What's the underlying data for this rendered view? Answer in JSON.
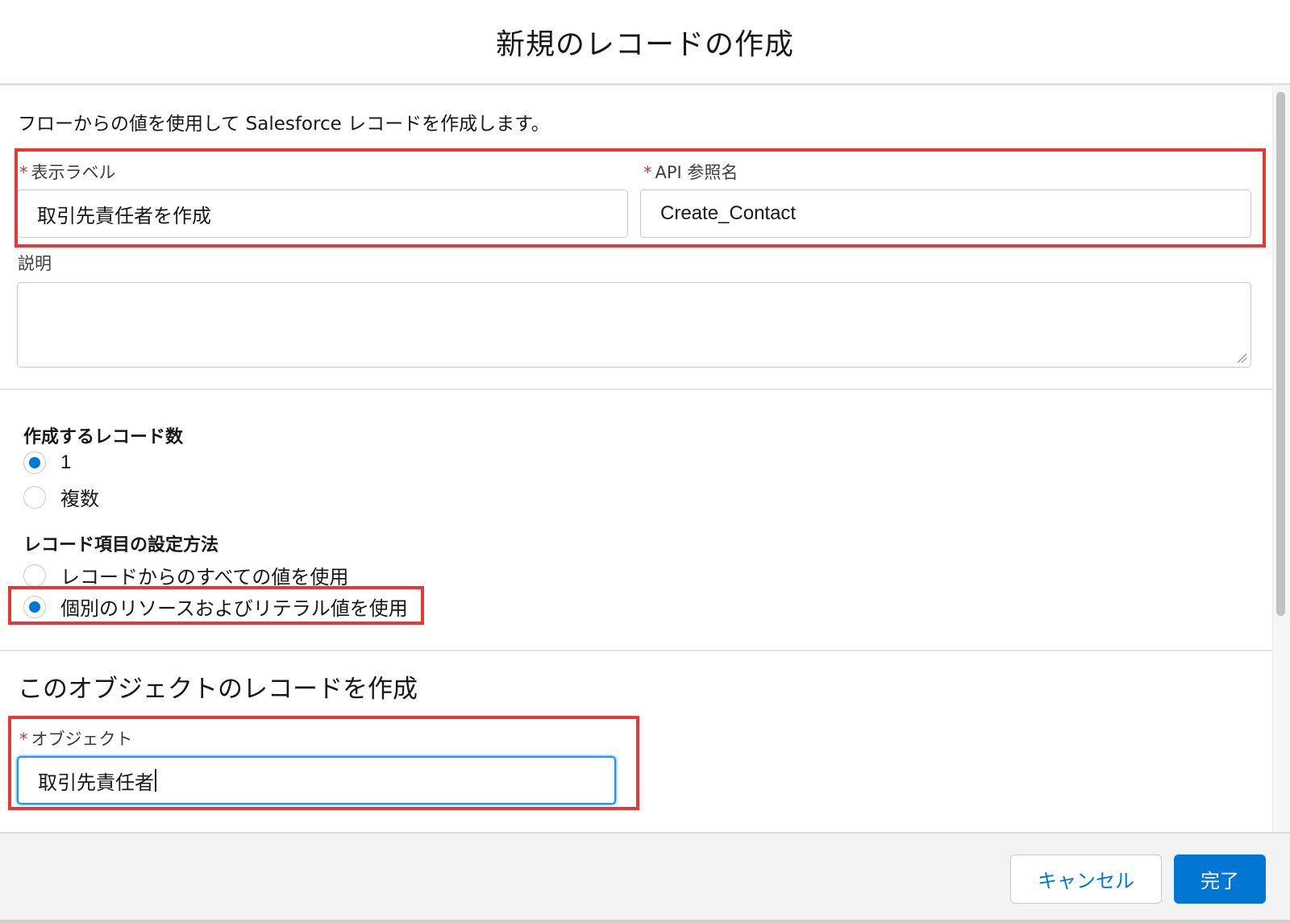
{
  "header": {
    "title": "新規のレコードの作成"
  },
  "content": {
    "description": "フローからの値を使用して Salesforce レコードを作成します。",
    "label_field": {
      "label": "表示ラベル",
      "required_mark": "*",
      "value": "取引先責任者を作成"
    },
    "api_field": {
      "label": "API 参照名",
      "required_mark": "*",
      "value": "Create_Contact"
    },
    "description_field": {
      "label": "説明",
      "value": ""
    },
    "record_count": {
      "label": "作成するレコード数",
      "options": [
        {
          "label": "1",
          "checked": true
        },
        {
          "label": "複数",
          "checked": false
        }
      ]
    },
    "field_setting": {
      "label": "レコード項目の設定方法",
      "options": [
        {
          "label": "レコードからのすべての値を使用",
          "checked": false
        },
        {
          "label": "個別のリソースおよびリテラル値を使用",
          "checked": true
        }
      ]
    },
    "object_section": {
      "title": "このオブジェクトのレコードを作成",
      "object_field": {
        "label": "オブジェクト",
        "required_mark": "*",
        "value": "取引先責任者"
      }
    }
  },
  "footer": {
    "cancel_label": "キャンセル",
    "done_label": "完了"
  },
  "colors": {
    "brand": "#0176d3",
    "highlight": "#e53939",
    "required": "#c23934"
  }
}
